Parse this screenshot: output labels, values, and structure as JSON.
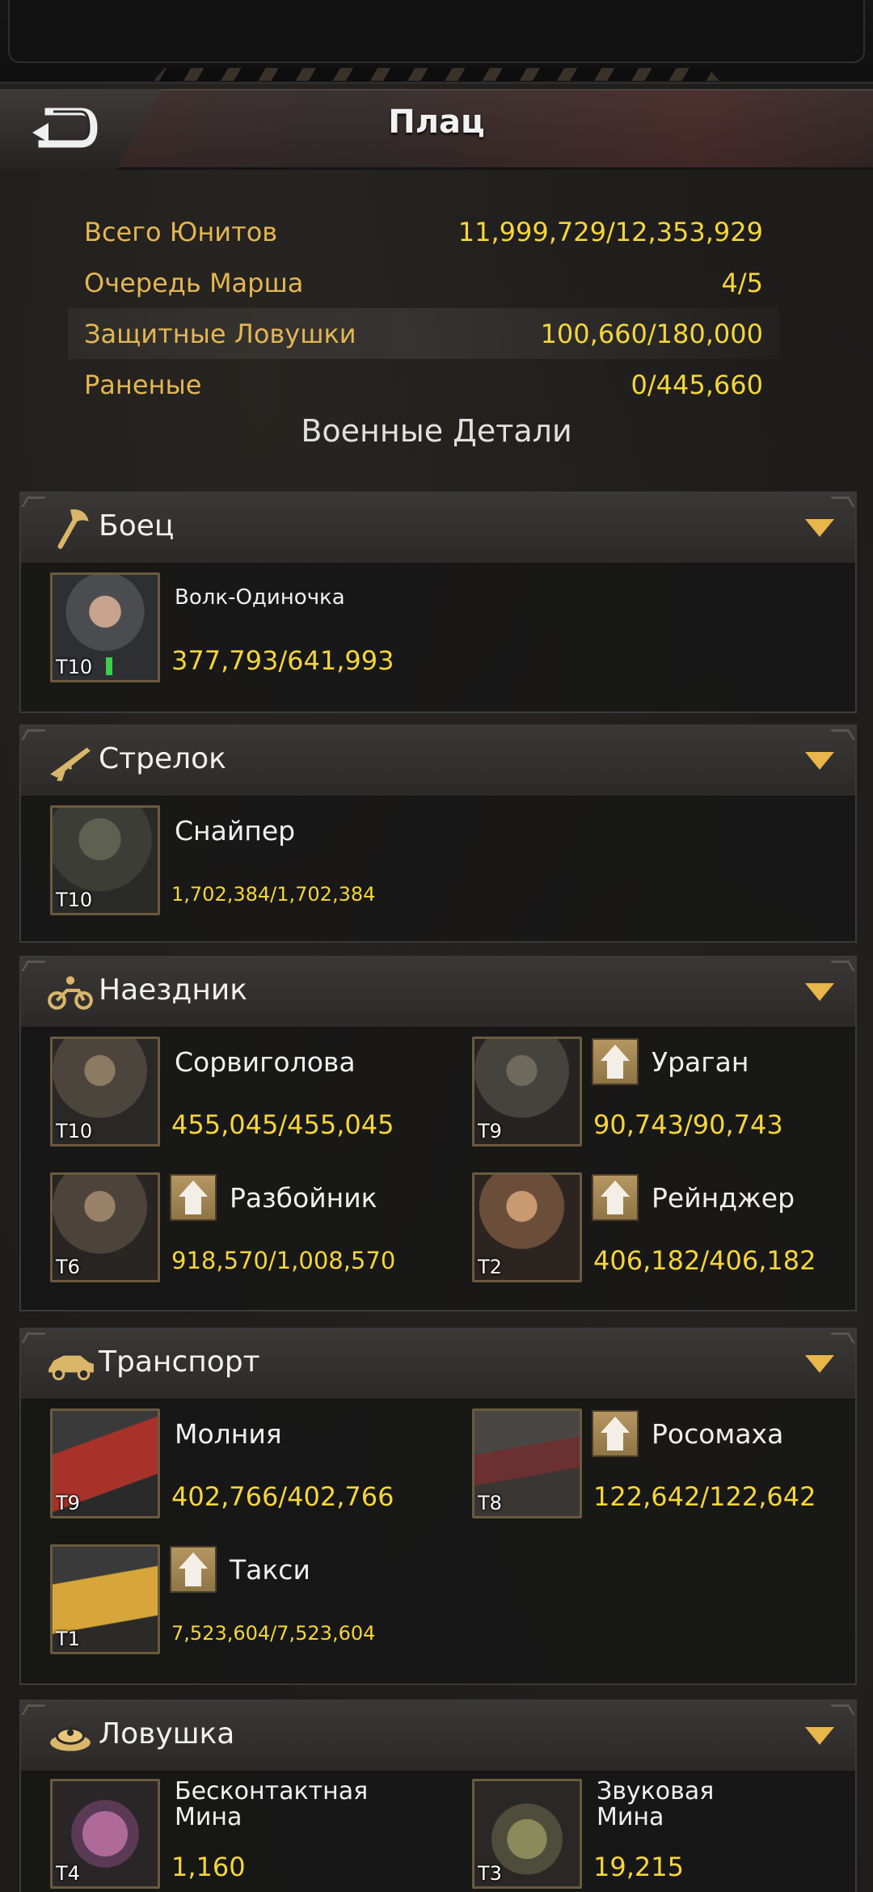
{
  "header": {
    "title": "Плац",
    "back_icon": "back-arrow-icon"
  },
  "stats": [
    {
      "label": "Всего Юнитов",
      "value": "11,999,729/12,353,929"
    },
    {
      "label": "Очередь Марша",
      "value": "4/5"
    },
    {
      "label": "Защитные Ловушки",
      "value": "100,660/180,000"
    },
    {
      "label": "Раненые",
      "value": "0/445,660"
    }
  ],
  "section_title": "Военные Детали",
  "categories": [
    {
      "label": "Боец",
      "icon": "axe-icon",
      "units": [
        {
          "name": "Волк-Одиночка",
          "tier": "T10",
          "count": "377,793/641,993",
          "upgrade": false
        }
      ]
    },
    {
      "label": "Стрелок",
      "icon": "rifle-icon",
      "units": [
        {
          "name": "Снайпер",
          "tier": "T10",
          "count": "1,702,384/1,702,384",
          "upgrade": false
        }
      ]
    },
    {
      "label": "Наездник",
      "icon": "motorcycle-icon",
      "units": [
        {
          "name": "Сорвиголова",
          "tier": "T10",
          "count": "455,045/455,045",
          "upgrade": false
        },
        {
          "name": "Ураган",
          "tier": "T9",
          "count": "90,743/90,743",
          "upgrade": true
        },
        {
          "name": "Разбойник",
          "tier": "T6",
          "count": "918,570/1,008,570",
          "upgrade": true
        },
        {
          "name": "Рейнджер",
          "tier": "T2",
          "count": "406,182/406,182",
          "upgrade": true
        }
      ]
    },
    {
      "label": "Транспорт",
      "icon": "car-icon",
      "units": [
        {
          "name": "Молния",
          "tier": "T9",
          "count": "402,766/402,766",
          "upgrade": false
        },
        {
          "name": "Росомаха",
          "tier": "T8",
          "count": "122,642/122,642",
          "upgrade": true
        },
        {
          "name": "Такси",
          "tier": "T1",
          "count": "7,523,604/7,523,604",
          "upgrade": true
        }
      ]
    },
    {
      "label": "Ловушка",
      "icon": "mine-icon",
      "units": [
        {
          "name": "Бесконтактная Мина",
          "tier": "T4",
          "count": "1,160",
          "upgrade": false
        },
        {
          "name": "Звуковая Мина",
          "tier": "T3",
          "count": "19,215",
          "upgrade": false
        }
      ]
    }
  ],
  "colors": {
    "accent_gold": "#f5d63a",
    "label_gold": "#e3b652",
    "chevron": "#e8b64a"
  }
}
